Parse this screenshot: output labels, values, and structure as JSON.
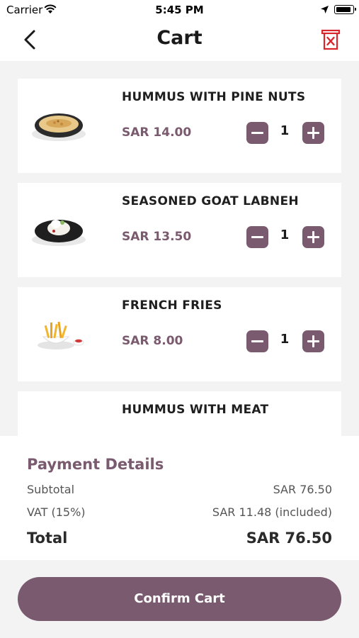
{
  "status_bar": {
    "carrier": "Carrier",
    "time": "5:45 PM"
  },
  "header": {
    "title": "Cart",
    "back_icon": "chevron-left-icon",
    "delete_icon": "trash-icon"
  },
  "items": [
    {
      "name": "HUMMUS WITH PINE NUTS",
      "price": "SAR 14.00",
      "quantity": "1"
    },
    {
      "name": "SEASONED GOAT LABNEH",
      "price": "SAR 13.50",
      "quantity": "1"
    },
    {
      "name": "FRENCH FRIES",
      "price": "SAR 8.00",
      "quantity": "1"
    },
    {
      "name": "HUMMUS WITH MEAT"
    }
  ],
  "payment": {
    "title": "Payment Details",
    "subtotal_label": "Subtotal",
    "subtotal_value": "SAR 76.50",
    "vat_label": "VAT (15%)",
    "vat_value": "SAR 11.48 (included)",
    "total_label": "Total",
    "total_value": "SAR 76.50"
  },
  "confirm_label": "Confirm Cart",
  "colors": {
    "accent": "#7a5a6e",
    "delete": "#d9262c",
    "background": "#f3f3f3"
  }
}
